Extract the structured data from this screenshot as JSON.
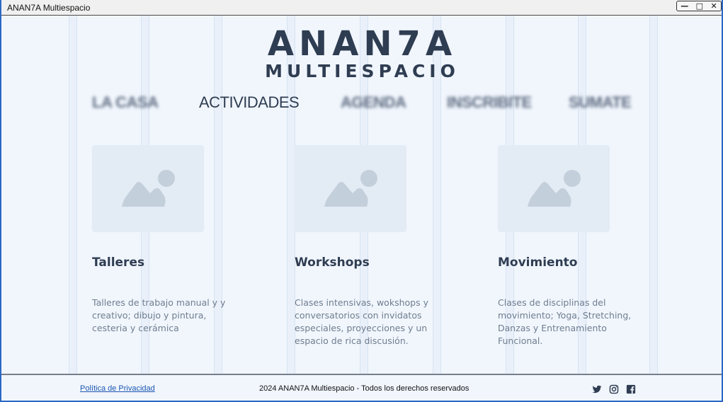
{
  "window": {
    "title": "ANAN7A Multiespacio",
    "controls": [
      "minimize",
      "maximize",
      "close"
    ]
  },
  "logo": {
    "main": "ANAN7A",
    "sub": "MULTIESPACIO"
  },
  "nav": {
    "items": [
      {
        "label": "LA CASA",
        "active": false
      },
      {
        "label": "ACTIVIDADES",
        "active": true
      },
      {
        "label": "AGENDA",
        "active": false
      },
      {
        "label": "INSCRIBITE",
        "active": false
      },
      {
        "label": "SUMATE",
        "active": false
      }
    ]
  },
  "cards": [
    {
      "title": "Talleres",
      "description": "Talleres de trabajo manual y  y creativo; dibujo y pintura, cesteria y cerámica",
      "icon": "image-placeholder-icon"
    },
    {
      "title": "Workshops",
      "description": "Clases intensivas, wokshops y conversatorios con invidatos especiales, proyecciones y un espacio de rica discusión.",
      "icon": "image-placeholder-icon"
    },
    {
      "title": "Movimiento",
      "description": "Clases de disciplinas del movimiento; Yoga, Stretching, Danzas y Entrenamiento Funcional.",
      "icon": "image-placeholder-icon"
    }
  ],
  "footer": {
    "privacy_label": "Política de Privacidad",
    "copyright": "2024 ANAN7A Multiespacio - Todos los derechos reservados",
    "social": [
      "twitter-icon",
      "instagram-icon",
      "facebook-icon"
    ]
  },
  "colors": {
    "text_dark": "#2f3d52",
    "text_muted": "#6f7d8f",
    "background": "#f1f6fd",
    "link": "#1a56b0",
    "window_border": "#2b69c4"
  }
}
